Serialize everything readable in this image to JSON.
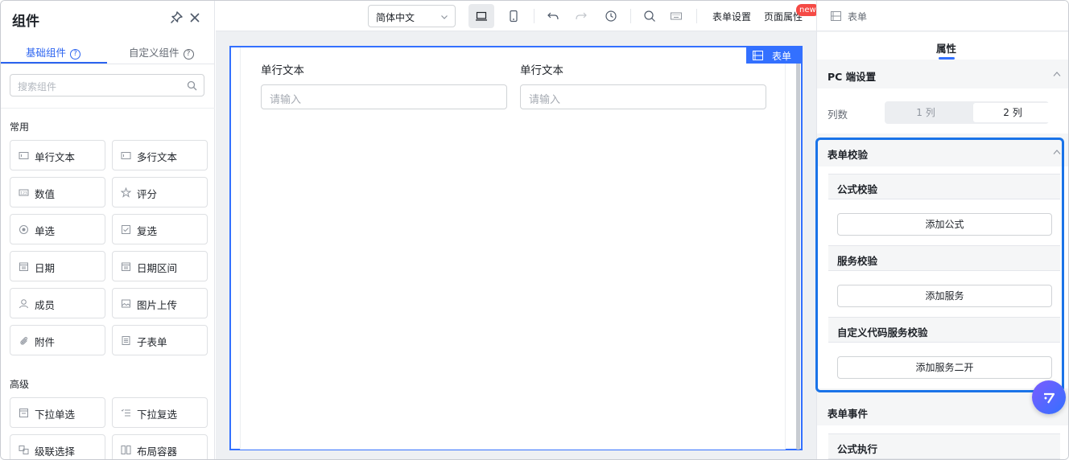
{
  "left_panel": {
    "title": "组件",
    "tabs": [
      "基础组件",
      "自定义组件"
    ],
    "search_placeholder": "搜索组件",
    "section_common": "常用",
    "section_advanced": "高级",
    "common_components": [
      "单行文本",
      "多行文本",
      "数值",
      "评分",
      "单选",
      "复选",
      "日期",
      "日期区间",
      "成员",
      "图片上传",
      "附件",
      "子表单"
    ],
    "advanced_components": [
      "下拉单选",
      "下拉复选",
      "级联选择",
      "布局容器"
    ]
  },
  "toolbar": {
    "language": "简体中文",
    "form_settings": "表单设置",
    "page_properties": "页面属性",
    "new_badge": "new"
  },
  "canvas": {
    "badge": "表单",
    "fields": [
      {
        "label": "单行文本",
        "placeholder": "请输入"
      },
      {
        "label": "单行文本",
        "placeholder": "请输入"
      }
    ]
  },
  "right_panel": {
    "header": "表单",
    "tab": "属性",
    "pc_settings": "PC 端设置",
    "columns_label": "列数",
    "column_options": [
      "1 列",
      "2 列"
    ],
    "column_selected": "2 列",
    "form_validation": "表单校验",
    "formula_validation": "公式校验",
    "add_formula": "添加公式",
    "service_validation": "服务校验",
    "add_service": "添加服务",
    "custom_code_validation": "自定义代码服务校验",
    "add_service_custom": "添加服务二开",
    "form_events": "表单事件",
    "formula_execution": "公式执行"
  },
  "colors": {
    "accent": "#3370ff",
    "highlight": "#1a73e8",
    "badge_red": "#f54a45"
  }
}
